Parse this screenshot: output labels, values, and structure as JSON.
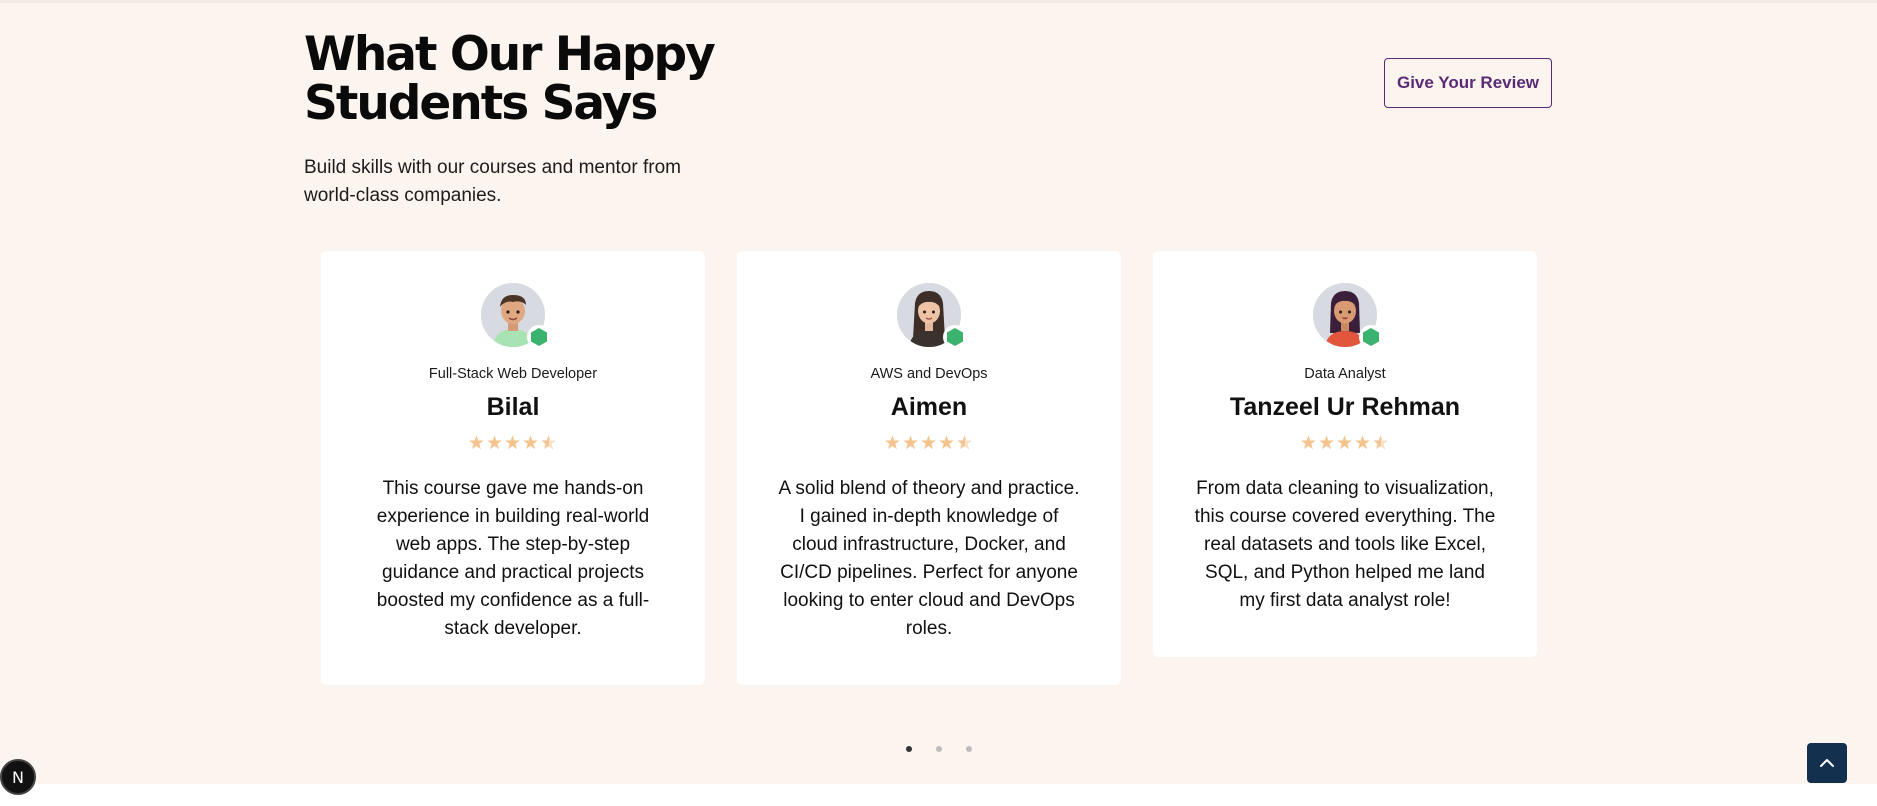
{
  "section": {
    "title": "What Our Happy Students Says",
    "subtitle": "Build skills with our courses and mentor from world-class companies.",
    "review_button": "Give Your Review"
  },
  "testimonials": [
    {
      "role": "Full-Stack Web Developer",
      "name": "Bilal",
      "rating": 4.5,
      "quote": "This course gave me hands-on experience in building real-world web apps. The step-by-step guidance and practical projects boosted my confidence as a full-stack developer."
    },
    {
      "role": "AWS and DevOps",
      "name": "Aimen",
      "rating": 4.5,
      "quote": "A solid blend of theory and practice. I gained in-depth knowledge of cloud infrastructure, Docker, and CI/CD pipelines. Perfect for anyone looking to enter cloud and DevOps roles."
    },
    {
      "role": "Data Analyst",
      "name": "Tanzeel Ur Rehman",
      "rating": 4.5,
      "quote": "From data cleaning to visualization, this course covered everything. The real datasets and tools like Excel, SQL, and Python helped me land my first data analyst role!"
    }
  ],
  "carousel": {
    "pages": 3,
    "active": 1
  },
  "floating": {
    "nextjs_badge": "N",
    "scroll_top_icon": "chevron-up-icon"
  },
  "colors": {
    "background": "#fcf4ef",
    "accent": "#5b2a73",
    "star": "#f5c38e",
    "badge": "#3bb36e",
    "scroll_top": "#13304f"
  }
}
